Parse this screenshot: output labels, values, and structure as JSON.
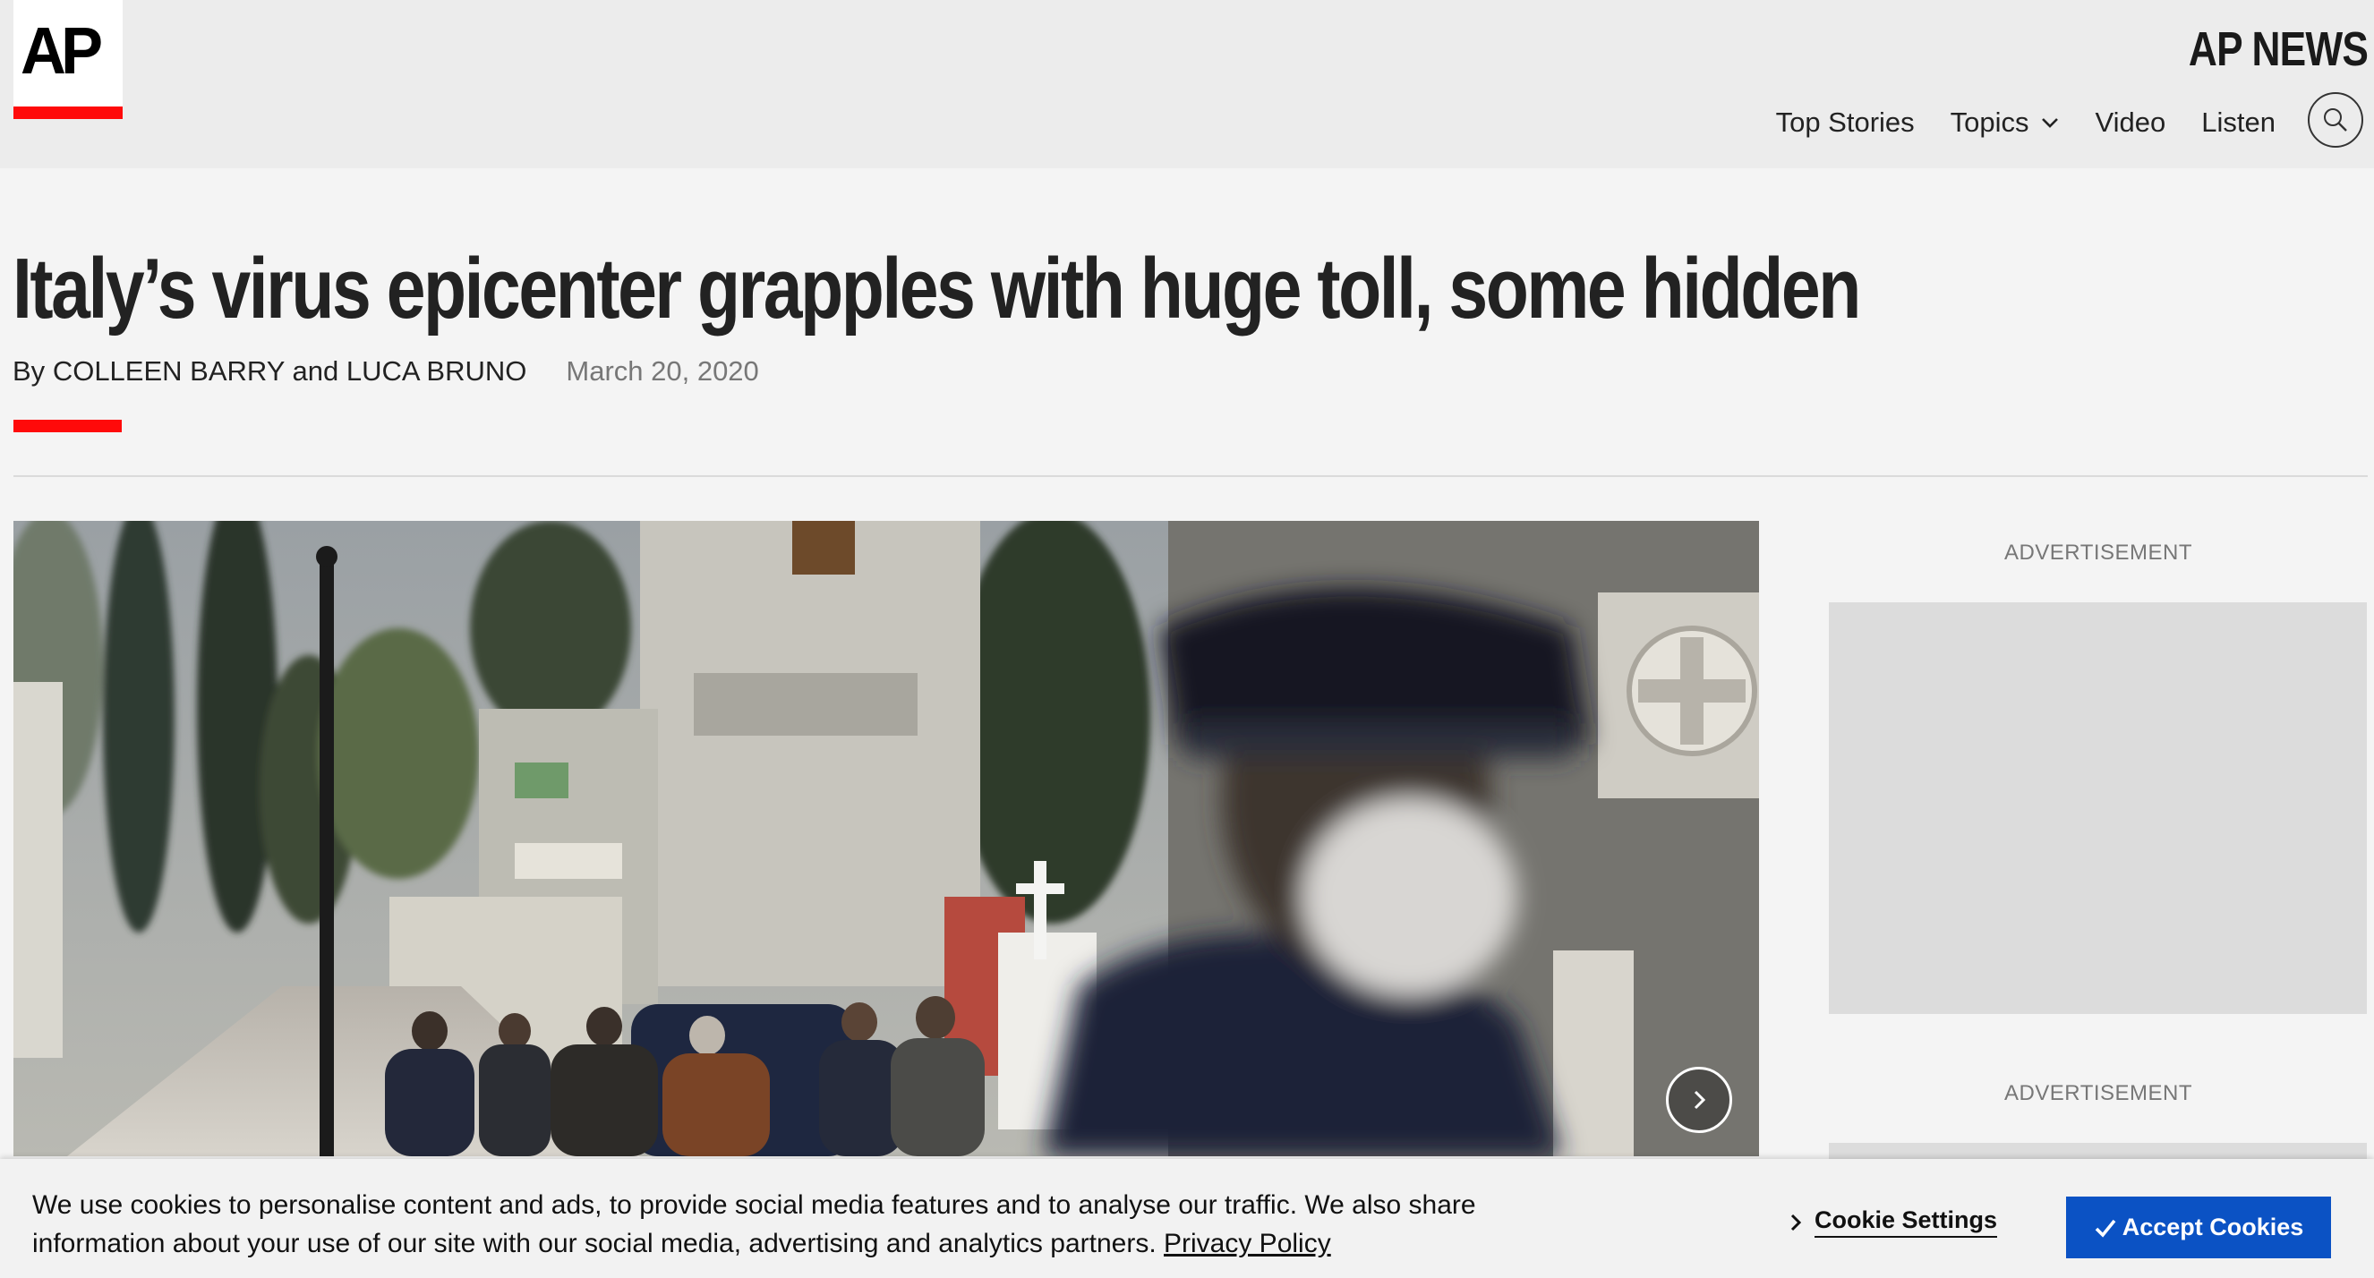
{
  "header": {
    "logo_text": "AP",
    "brand": "AP NEWS",
    "nav": [
      {
        "label": "Top Stories"
      },
      {
        "label": "Topics"
      },
      {
        "label": "Video"
      },
      {
        "label": "Listen"
      }
    ],
    "search_icon": "search-icon"
  },
  "article": {
    "headline": "Italy’s virus epicenter grapples with huge toll, some hidden",
    "byline_prefix": "By",
    "author_1": "COLLEEN BARRY",
    "byline_joiner": "and",
    "author_2": "LUCA BRUNO",
    "date": "March 20, 2020"
  },
  "photo": {
    "next_icon": "chevron-right-icon"
  },
  "ads": {
    "label_1": "ADVERTISEMENT",
    "label_2": "ADVERTISEMENT"
  },
  "cookie_banner": {
    "text": "We use cookies to personalise content and ads, to provide social media features and to analyse our traffic. We also share information about your use of our site with our social media, advertising and analytics partners.",
    "privacy_link": "Privacy Policy",
    "settings_label": "Cookie Settings",
    "accept_label": "Accept Cookies",
    "accept_color": "#0b52c4"
  },
  "colors": {
    "accent_red": "#ff0a0a",
    "header_bg": "#ececec",
    "page_bg": "#f4f4f4"
  }
}
